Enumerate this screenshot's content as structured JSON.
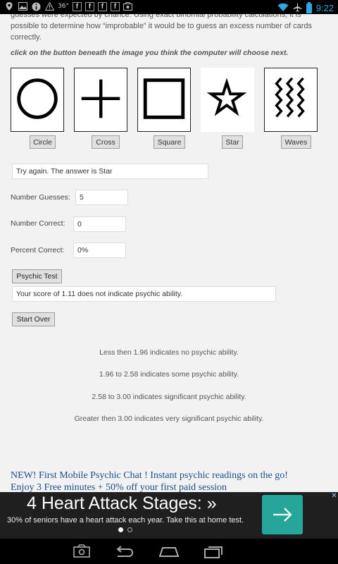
{
  "status_bar": {
    "temperature": "36°",
    "time": "9:22",
    "notification_icons": [
      "location-icon",
      "image-icon",
      "info-icon",
      "warning-icon",
      "facebook-icon",
      "facebook-icon",
      "facebook-icon",
      "facebook-icon",
      "gallery-icon"
    ],
    "facebook_letter": "f",
    "colors": {
      "time": "#2ea8e6",
      "battery": "#2ea8e6"
    }
  },
  "intro_text": "guesses were expected by chance. Using exact binomial probability calculations, it is possible to determine how “improbable” it would be to guess an excess number of cards correctly.",
  "instruction": "click on the button beneath the image you think the computer will choose next.",
  "cards": [
    {
      "id": "circle",
      "label": "Circle",
      "icon": "circle-icon"
    },
    {
      "id": "cross",
      "label": "Cross",
      "icon": "cross-icon"
    },
    {
      "id": "square",
      "label": "Square",
      "icon": "square-icon"
    },
    {
      "id": "star",
      "label": "Star",
      "icon": "star-icon"
    },
    {
      "id": "waves",
      "label": "Waves",
      "icon": "waves-icon"
    }
  ],
  "answer_text": "Try again. The answer is Star",
  "stats": {
    "guesses_label": "Number Guesses:",
    "guesses_value": "5",
    "correct_label": "Number Correct:",
    "correct_value": "0",
    "percent_label": "Percent Correct:",
    "percent_value": "0%"
  },
  "psychic_test_button": "Psychic Test",
  "score_text": "Your score of 1.11 does not indicate psychic ability.",
  "start_over_button": "Start Over",
  "scale": [
    "Less then 1.96 indicates no psychic ability.",
    "1.96 to 2.58 indicates some psychic ability.",
    "2.58 to 3.00 indicates significant psychic ability.",
    "Greater then 3.00 indicates very significant psychic ability."
  ],
  "promo": {
    "line1": "NEW! First Mobile Psychic Chat ! Instant psychic readings on the go!",
    "line2": "Enjoy 3 Free minutes + 50% off your first paid session"
  },
  "ad": {
    "headline": "4 Heart Attack Stages: »",
    "subtext": "30% of seniors have a heart attack each year. Take this at home test.",
    "close_symbol": "✕",
    "colors": {
      "background": "#1f1f1f",
      "button": "#26a69a"
    }
  },
  "nav": [
    "screenshot-icon",
    "back-icon",
    "home-icon",
    "recent-apps-icon"
  ]
}
